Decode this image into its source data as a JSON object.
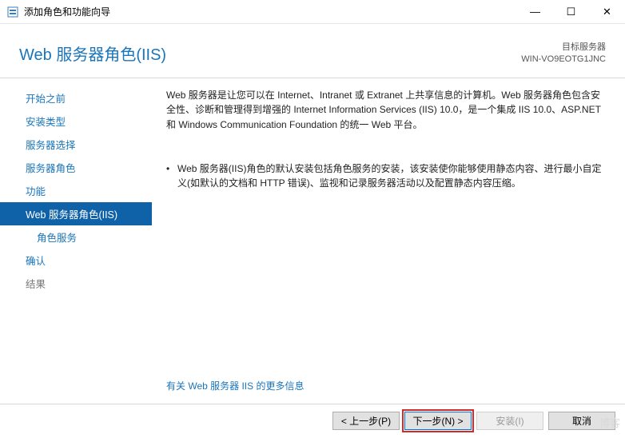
{
  "window": {
    "title": "添加角色和功能向导",
    "controls": {
      "min": "—",
      "max": "☐",
      "close": "✕"
    }
  },
  "header": {
    "page_title": "Web 服务器角色(IIS)",
    "target_label": "目标服务器",
    "target_name": "WIN-VO9EOTG1JNC"
  },
  "sidebar": {
    "items": [
      {
        "label": "开始之前",
        "enabled": true
      },
      {
        "label": "安装类型",
        "enabled": true
      },
      {
        "label": "服务器选择",
        "enabled": true
      },
      {
        "label": "服务器角色",
        "enabled": true
      },
      {
        "label": "功能",
        "enabled": true
      },
      {
        "label": "Web 服务器角色(IIS)",
        "enabled": true,
        "selected": true
      },
      {
        "label": "角色服务",
        "enabled": true,
        "indent": true
      },
      {
        "label": "确认",
        "enabled": true
      },
      {
        "label": "结果",
        "enabled": false
      }
    ]
  },
  "content": {
    "intro": "Web 服务器是让您可以在 Internet、Intranet 或 Extranet 上共享信息的计算机。Web 服务器角色包含安全性、诊断和管理得到增强的 Internet Information Services (IIS) 10.0，是一个集成 IIS 10.0、ASP.NET 和 Windows Communication Foundation 的统一 Web 平台。",
    "bullet": "Web 服务器(IIS)角色的默认安装包括角色服务的安装，该安装使你能够使用静态内容、进行最小自定义(如默认的文档和 HTTP 错误)、监视和记录服务器活动以及配置静态内容压缩。",
    "more_link": "有关 Web 服务器 IIS 的更多信息"
  },
  "footer": {
    "prev": "< 上一步(P)",
    "next": "下一步(N) >",
    "install": "安装(I)",
    "cancel": "取消"
  },
  "watermark": "博客"
}
